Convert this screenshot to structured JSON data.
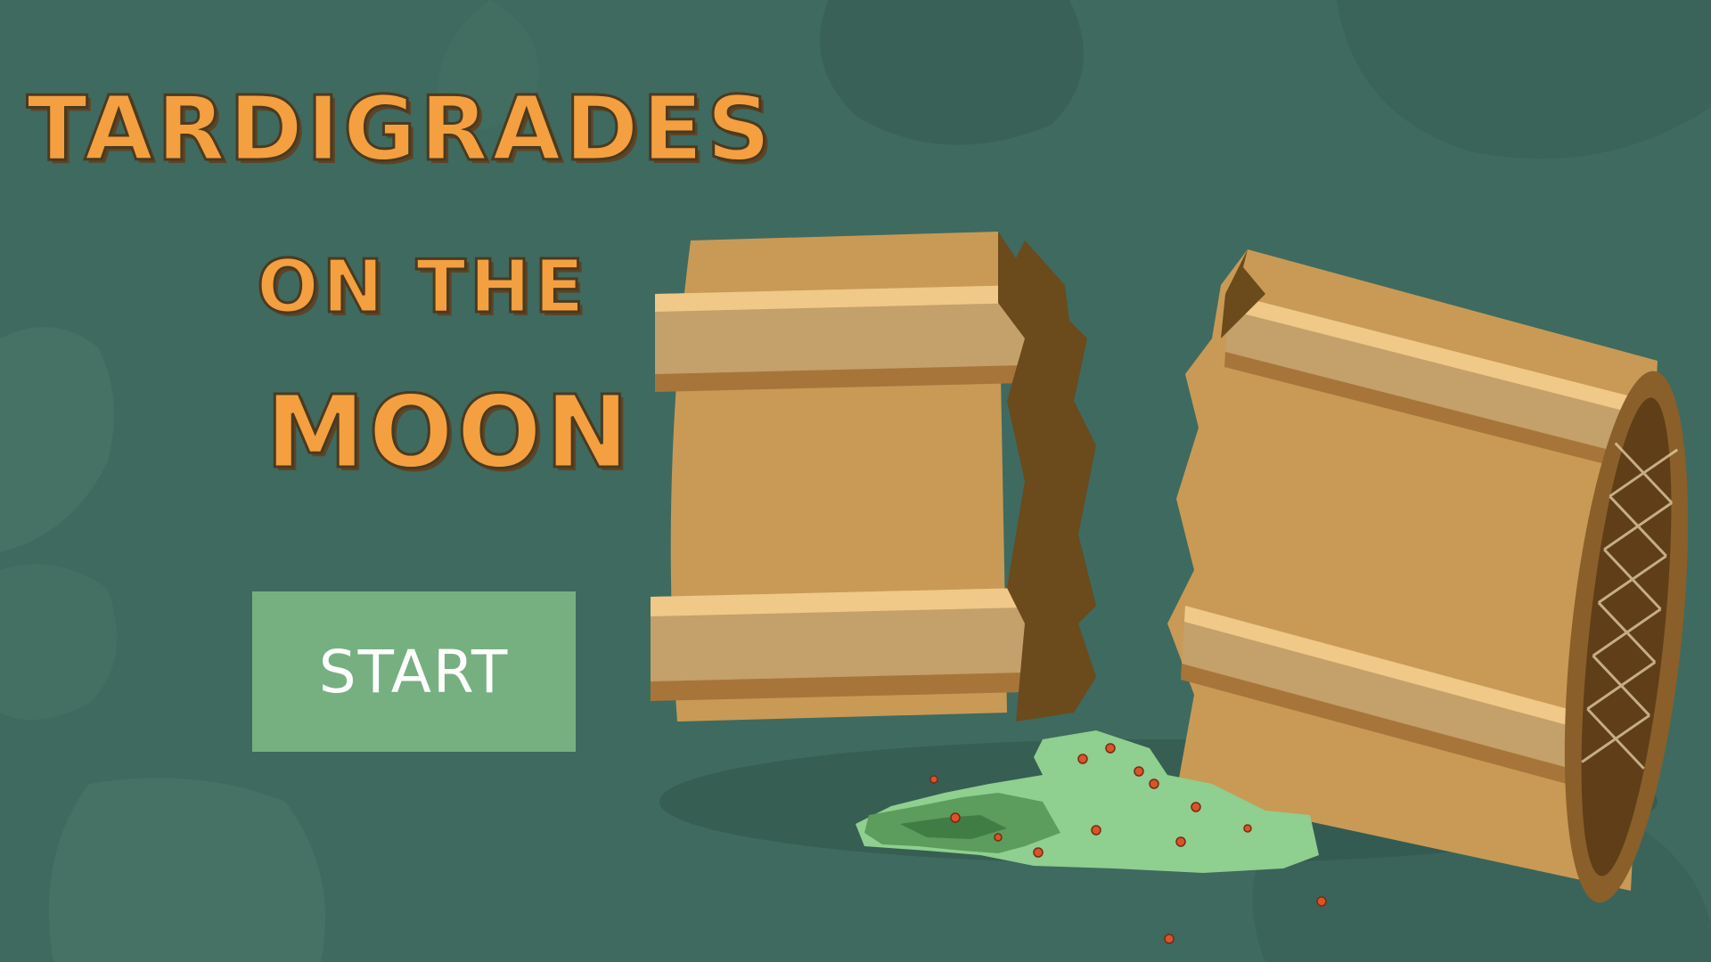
{
  "title": {
    "line1": "TARDIGRADES",
    "line2": "ON THE",
    "line3": "MOON"
  },
  "start_button": {
    "label": "START"
  },
  "colors": {
    "background": "#3f6a5f",
    "title": "#f4a040",
    "button": "#76b080",
    "barrel": "#c99a55",
    "slime": "#8fcf8f"
  },
  "scene": {
    "object": "broken-barrel",
    "tardigrade_count": 14
  }
}
